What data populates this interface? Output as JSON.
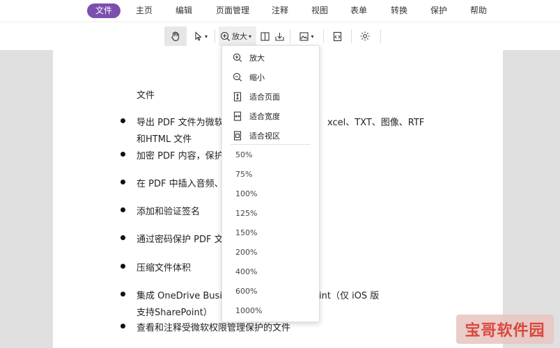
{
  "menu": {
    "items": [
      {
        "label": "文件",
        "active": true
      },
      {
        "label": "主页"
      },
      {
        "label": "编辑"
      },
      {
        "label": "页面管理"
      },
      {
        "label": "注释"
      },
      {
        "label": "视图"
      },
      {
        "label": "表单"
      },
      {
        "label": "转换"
      },
      {
        "label": "保护"
      },
      {
        "label": "帮助"
      }
    ]
  },
  "toolbar": {
    "zoom_label": "放大"
  },
  "dropdown": {
    "zoom_in": "放大",
    "zoom_out": "缩小",
    "fit_page": "适合页面",
    "fit_width": "适合宽度",
    "fit_view": "适合视区",
    "percentages": [
      "50%",
      "75%",
      "100%",
      "125%",
      "150%",
      "200%",
      "400%",
      "600%",
      "1000%"
    ]
  },
  "document": {
    "heading": "文件",
    "lines": [
      "导出 PDF 文件为微软",
      "xcel、TXT、图像、RTF",
      "和HTML 文件",
      "加密 PDF 内容，保护",
      "在 PDF 中插入音频、",
      "添加和验证签名",
      "通过密码保护 PDF 文",
      "压缩文件体积",
      "集成 OneDrive Busin",
      "int（仅 iOS 版",
      "支持SharePoint）",
      "查看和注释受微软权限管理保护的文件"
    ]
  },
  "watermark": {
    "text": "宝哥软件园"
  }
}
